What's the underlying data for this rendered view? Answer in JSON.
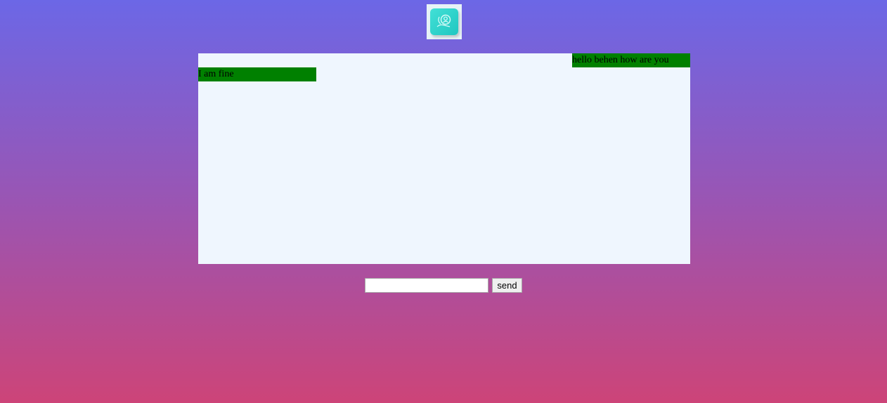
{
  "header": {
    "logo_icon": "chat-people-icon",
    "logo_colors": {
      "tile": "#2fd1c9",
      "frame": "#e7f3f6"
    }
  },
  "chat": {
    "messages": [
      {
        "side": "right",
        "text": "hello behen how are you"
      },
      {
        "side": "left",
        "text": "I am fine"
      }
    ],
    "bubble_color": "#008000",
    "panel_color": "#eff6fe"
  },
  "composer": {
    "input_value": "",
    "input_placeholder": "",
    "send_label": "send"
  },
  "background": {
    "gradient_top": "#6c67e6",
    "gradient_bottom": "#cd4478"
  }
}
